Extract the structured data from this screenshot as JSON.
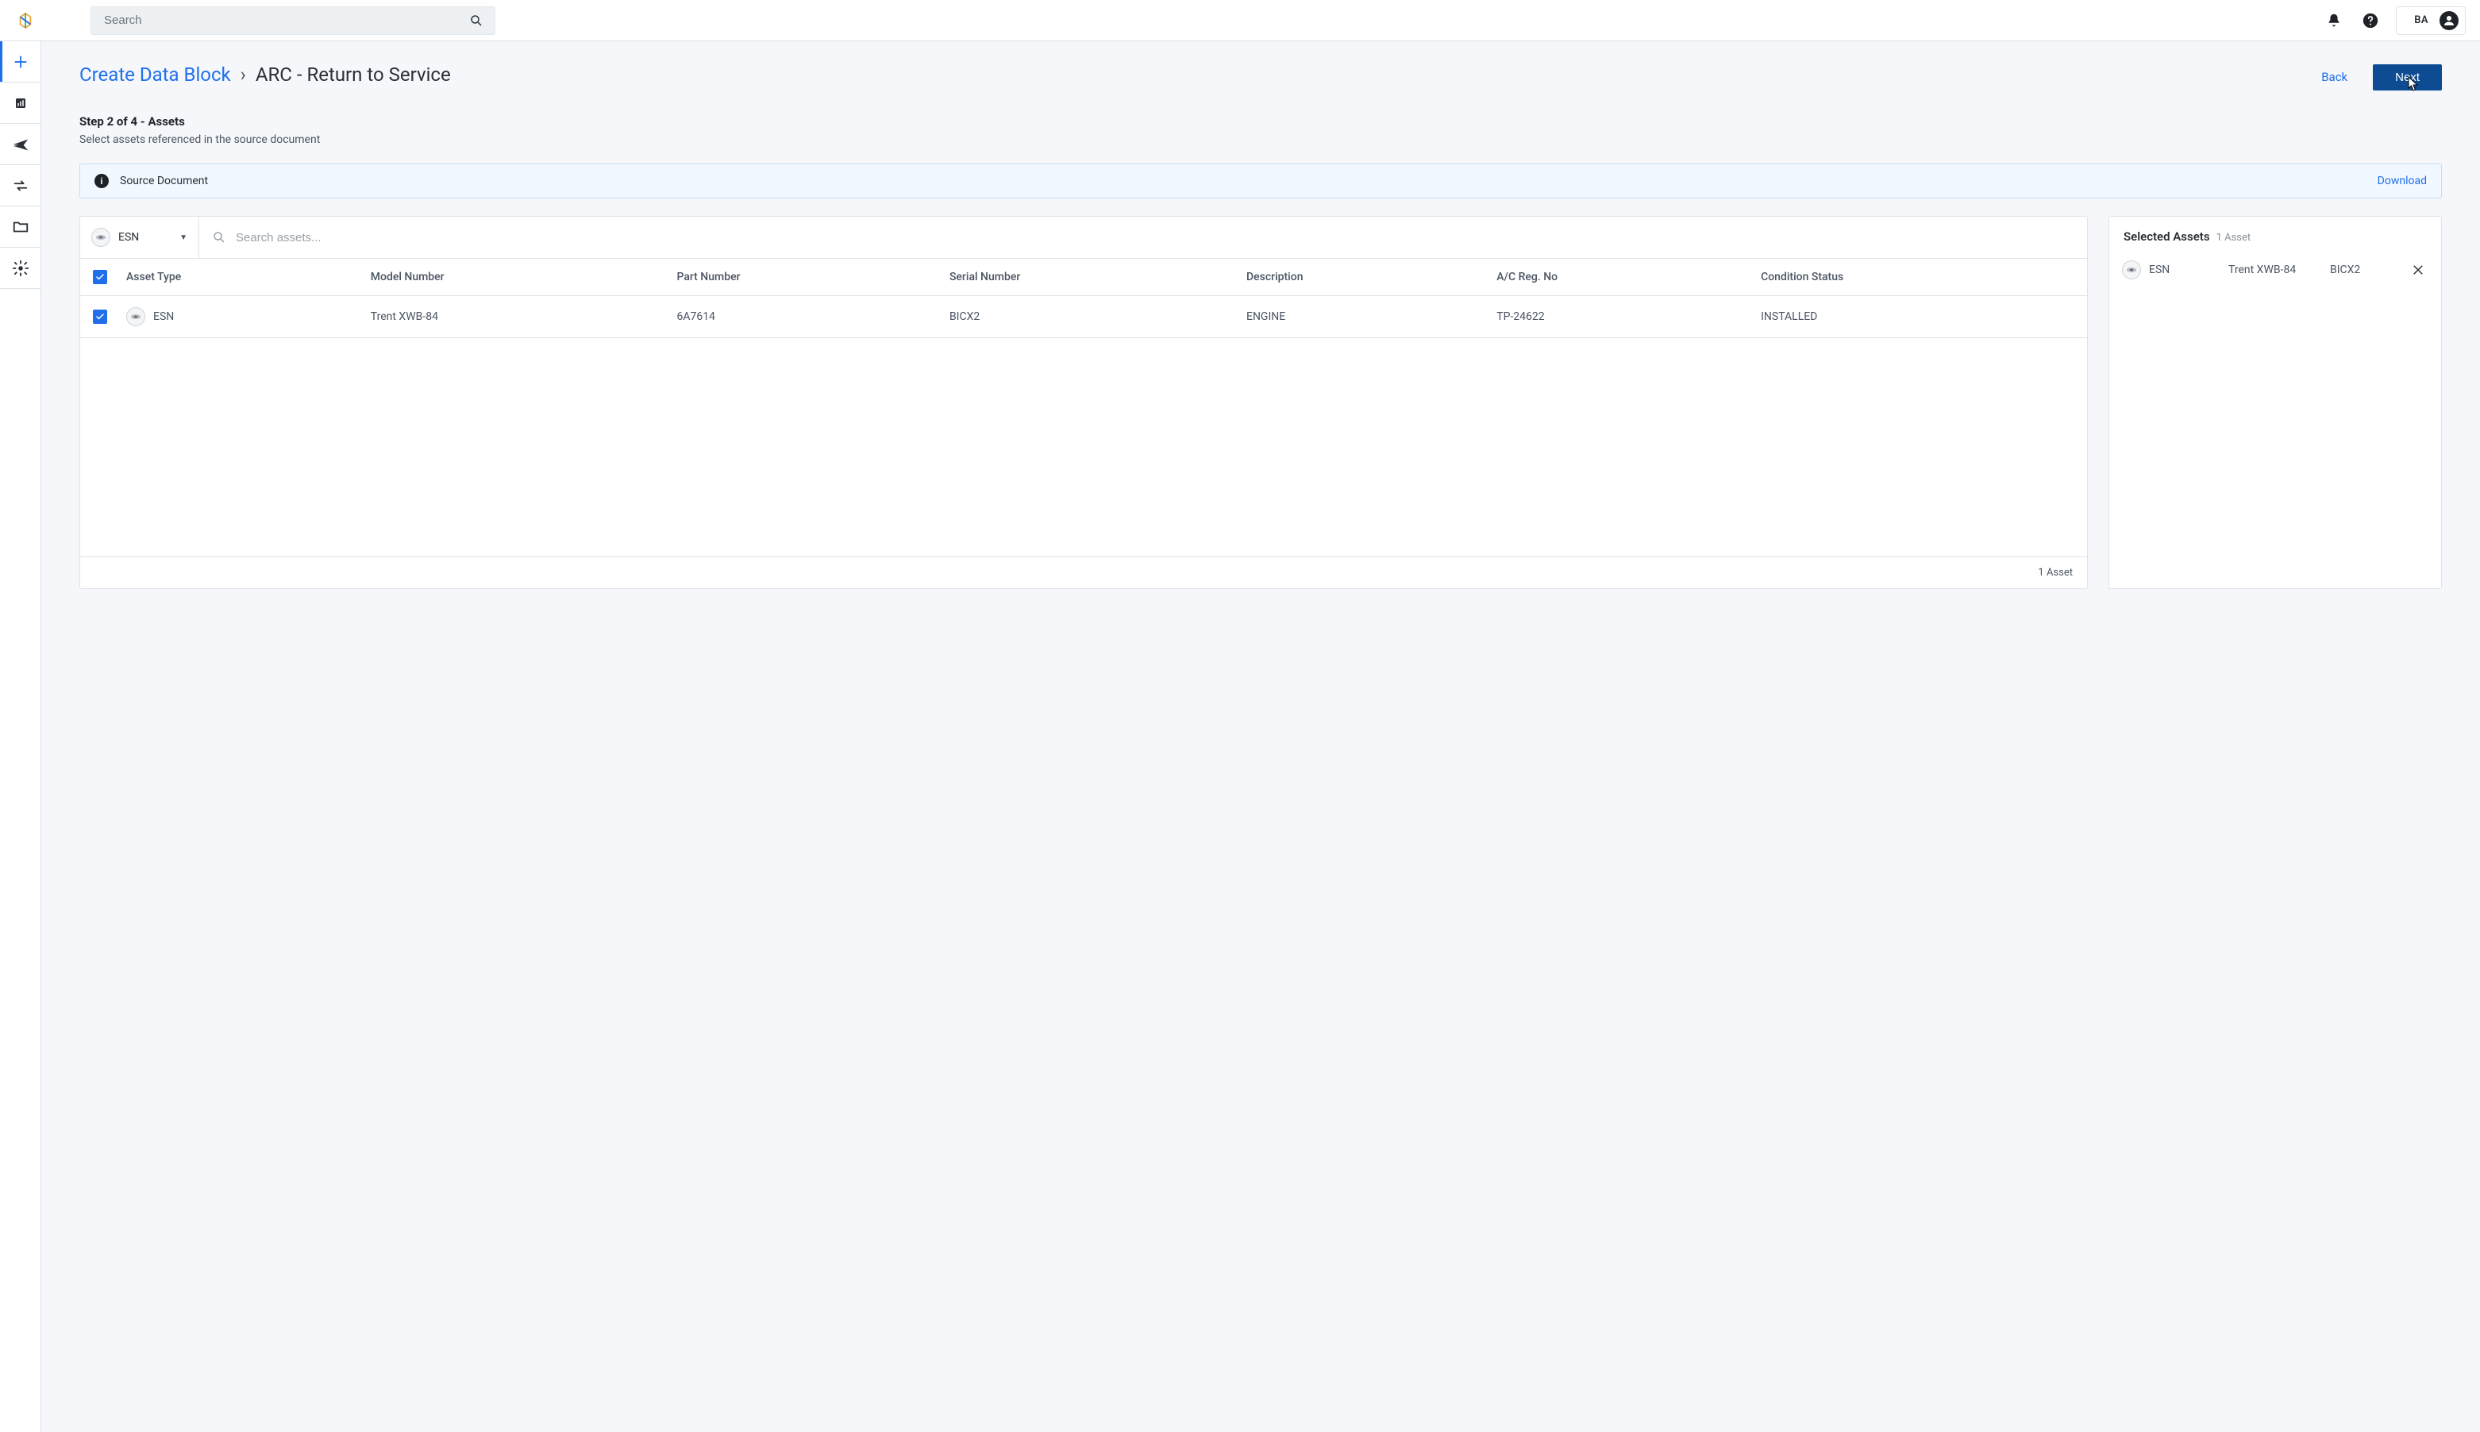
{
  "header": {
    "search_placeholder": "Search",
    "user_initials": "BA"
  },
  "breadcrumb": {
    "root": "Create Data Block",
    "separator": "›",
    "current": "ARC - Return to Service"
  },
  "actions": {
    "back": "Back",
    "next": "Next"
  },
  "step": {
    "title": "Step 2 of 4 - Assets",
    "sub": "Select assets referenced in the source document"
  },
  "banner": {
    "label": "Source Document",
    "download": "Download"
  },
  "assets_panel": {
    "type_filter": "ESN",
    "search_placeholder": "Search assets...",
    "columns": {
      "asset_type": "Asset Type",
      "model_number": "Model Number",
      "part_number": "Part Number",
      "serial_number": "Serial Number",
      "description": "Description",
      "ac_reg": "A/C Reg. No",
      "condition": "Condition Status"
    },
    "rows": [
      {
        "asset_type": "ESN",
        "model_number": "Trent XWB-84",
        "part_number": "6A7614",
        "serial_number": "BICX2",
        "description": "ENGINE",
        "ac_reg": "TP-24622",
        "condition": "INSTALLED"
      }
    ],
    "footer": "1 Asset"
  },
  "selected_panel": {
    "title": "Selected Assets",
    "count": "1 Asset",
    "rows": [
      {
        "asset_type": "ESN",
        "model_number": "Trent XWB-84",
        "serial_number": "BICX2"
      }
    ]
  }
}
